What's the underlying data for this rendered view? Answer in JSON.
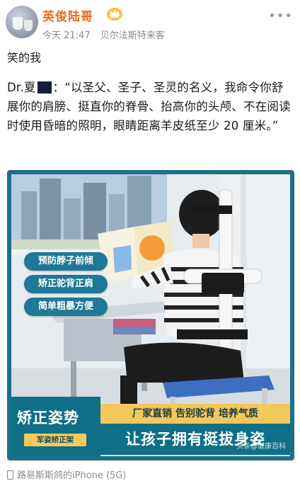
{
  "post": {
    "username": "英俊陆哥",
    "time": "今天 21:47",
    "source": "贝尔法斯特来客",
    "caption": "笑的我",
    "quote_prefix": "Dr.夏",
    "quote_text": "：“以圣父、圣子、圣灵的名义，我命令你舒展你的肩膀、挺直你的脊骨、抬高你的头颅、不在阅读时使用昏暗的照明，眼睛距离羊皮纸至少 20 厘米。”",
    "device": "路易斯斯鸽的iPhone (5G)"
  },
  "icons": {
    "vip": "crown-badge-icon",
    "more": "more-dots-icon",
    "phone": "phone-icon"
  },
  "ad": {
    "pills": [
      "预防脖子前倾",
      "矫正驼背正肩",
      "简单粗暴方便"
    ],
    "banner_title": "矫正姿势",
    "banner_tag": "军姿矫正架",
    "banner_line1": "厂家直销  告别驼背  培养气质",
    "banner_line2": "让孩子拥有挺拔身姿",
    "watermark": "头条@健康百科"
  },
  "colors": {
    "username": "#e86a1a",
    "ad_teal": "#1e7896",
    "ad_yellow": "#f3c75a"
  }
}
